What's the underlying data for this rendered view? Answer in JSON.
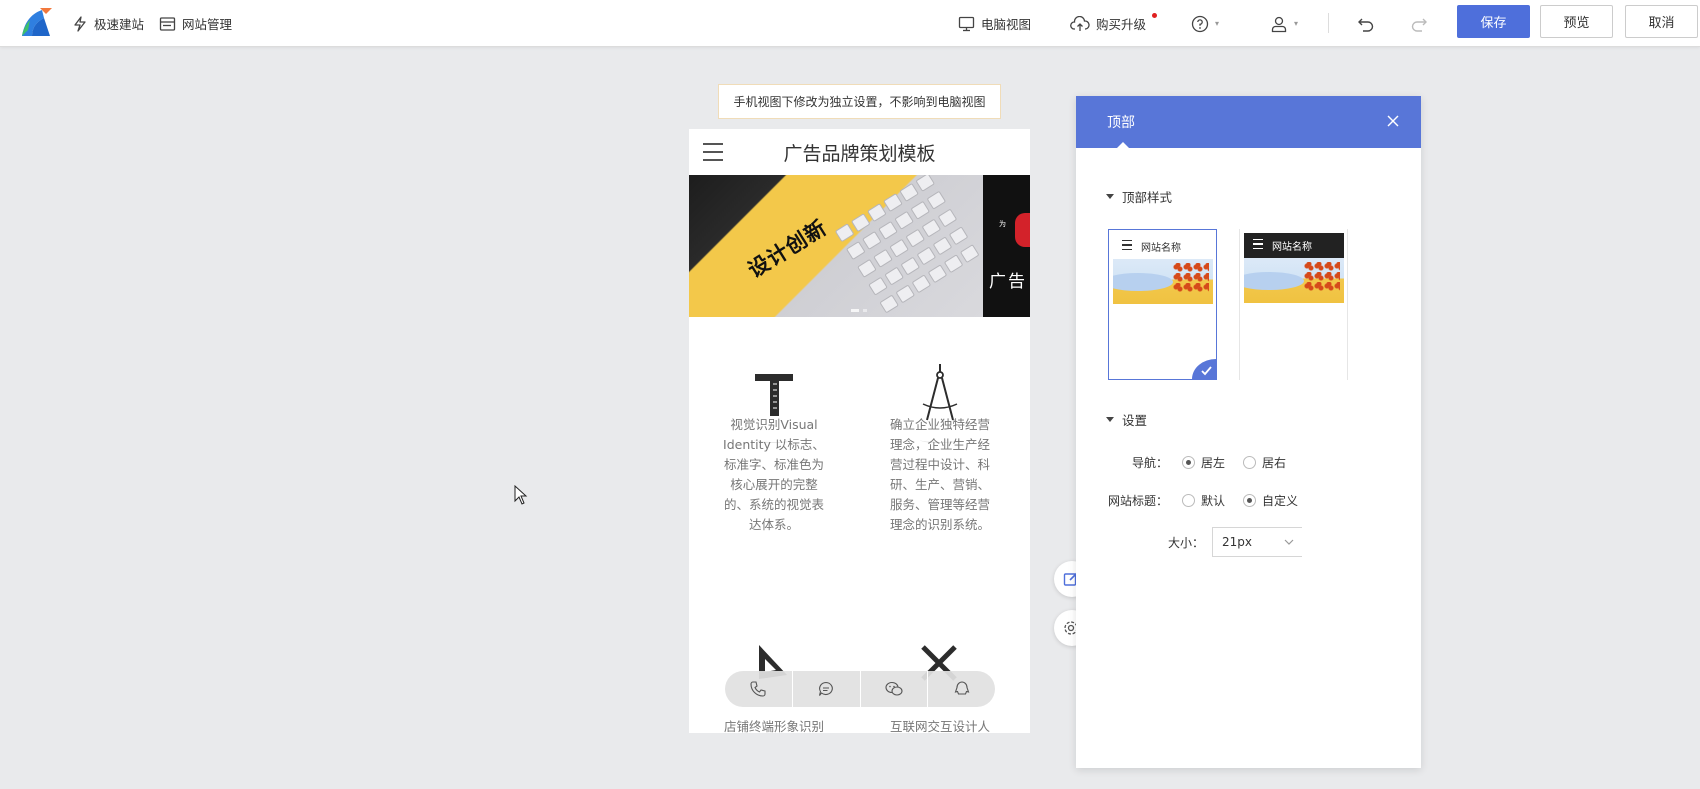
{
  "topbar": {
    "quick_build": "极速建站",
    "site_manage": "网站管理",
    "pc_view": "电脑视图",
    "buy_upgrade": "购买升级",
    "save": "保存",
    "preview": "预览",
    "cancel": "取消",
    "accent_color": "#4e6fdb"
  },
  "notice": "手机视图下修改为独立设置，不影响到电脑视图",
  "phone": {
    "title": "广告品牌策划模板",
    "banner": {
      "slogan": "设计创新",
      "right_text": "广告",
      "small_mark": "为"
    },
    "features": [
      {
        "icon": "t-square-ruler-icon",
        "text": "视觉识别Visual Identity 以标志、标准字、标准色为核心展开的完整的、系统的视觉表达体系。"
      },
      {
        "icon": "drafting-compass-icon",
        "text": "确立企业独特经营理念，企业生产经营过程中设计、科研、生产、营销、服务、管理等经营理念的识别系统。"
      },
      {
        "icon": "triangle-ruler-icon",
        "text": "店铺终端形象识别"
      },
      {
        "icon": "cross-tools-icon",
        "text": "互联网交互设计人"
      }
    ],
    "contact_icons": [
      "phone-icon",
      "message-icon",
      "wechat-icon",
      "qq-icon"
    ]
  },
  "panel": {
    "title": "顶部",
    "header_color": "#5876d8",
    "style_section": "顶部样式",
    "style_options": [
      {
        "site_name": "网站名称",
        "theme": "light",
        "selected": true
      },
      {
        "site_name": "网站名称",
        "theme": "dark",
        "selected": false
      }
    ],
    "settings_section": "设置",
    "nav_label": "导航：",
    "nav_options": [
      "居左",
      "居右"
    ],
    "nav_selected": "居左",
    "site_title_label": "网站标题：",
    "site_title_options": [
      "默认",
      "自定义"
    ],
    "site_title_selected": "自定义",
    "size_label": "大小：",
    "size_value": "21px"
  }
}
